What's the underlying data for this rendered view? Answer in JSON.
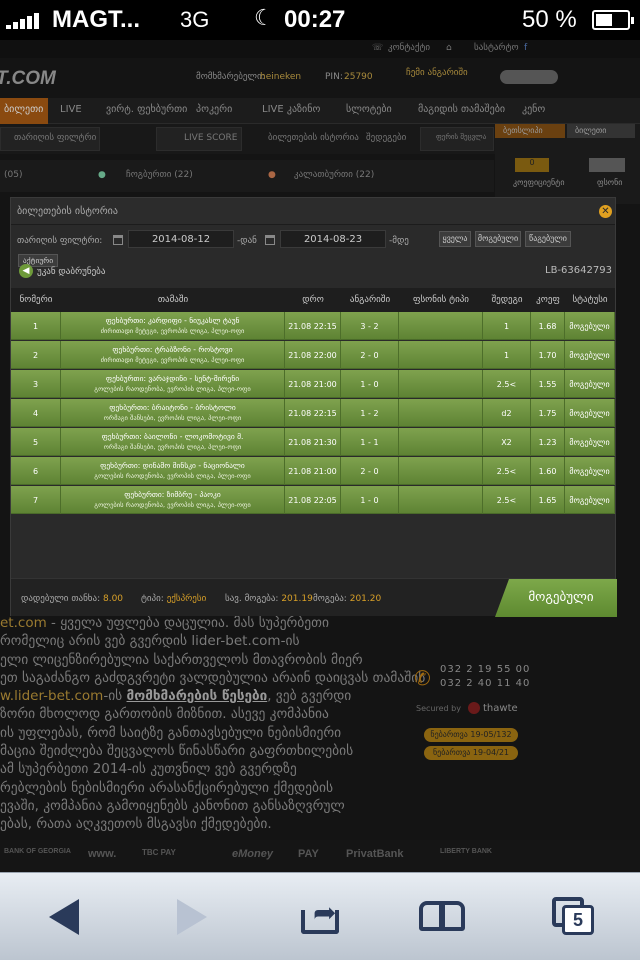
{
  "status_bar": {
    "carrier": "MAGT...",
    "network": "3G",
    "time": "00:27",
    "battery": "50 %",
    "battery_level": 0.5
  },
  "site": {
    "top_links": [
      "კონტაქტი",
      "სასტარტო"
    ],
    "logo": "T.COM",
    "user_label": "მომხმარებელი:",
    "username": "heineken",
    "pin_label": "PIN:",
    "pin": "25790",
    "balance_label": "ჩემი ანგარიში",
    "nav": [
      "ბილეთი",
      "LIVE",
      "ვირტ. ფეხბურთი",
      "პოკერი",
      "LIVE კაზინო",
      "სლოტები",
      "მაგიდის თამაშები",
      "კენო"
    ],
    "subnav": [
      "თარიღის ფილტრი",
      "LIVE SCORE",
      "ბილეთების ისტორია",
      "შედეგები",
      "ფერის შეცვლა"
    ],
    "sports": [
      "(05)",
      "ჩოგბურთი (22)",
      "კალათბურთი (22)"
    ],
    "side_tabs": [
      "ბეთსლიპი",
      "ბილეთი"
    ],
    "side_value": "0",
    "side_labels": [
      "კოეფიციენტი",
      "ფსონი"
    ],
    "footer_lines": [
      {
        "hl": "et.com",
        "rest": " - ყველა უფლება დაცულია. მას სუპერბეთი"
      },
      {
        "hl": "",
        "rest": "რომელიც არის ვებ გვერდის lider-bet.com-ის"
      },
      {
        "hl": "",
        "rest": "ელი ლიცენზირებულია საქართველოს მთავრობის მიერ"
      },
      {
        "hl": "",
        "rest": "ეთ საგაძანგო გაძდგვრეტი ვალდებულია არაინ დაიცვას თამაშის"
      },
      {
        "hl": "w.lider-bet.com",
        "rest": "-ის ",
        "ul": "მომხმარების წესები",
        "rest2": ", ვებ გვერდი"
      },
      {
        "hl": "",
        "rest": "ზორი მხოლოდ გართობის მიზნით. ასევე კომპანია"
      },
      {
        "hl": "",
        "rest": "ის უფლებას, რომ საიტზე განთავსებული ნებისმიერი"
      },
      {
        "hl": "",
        "rest": "მაცია შეიძლება შეცვალოს წინასწარი გაფრთხილების"
      },
      {
        "hl": "",
        "rest": "ამ სუპერბეთი 2014-ის კუთვნილ ვებ გვერდზე"
      },
      {
        "hl": "",
        "rest": "რებლების ნებისმიერი არასანქცირებული ქმედების"
      },
      {
        "hl": "",
        "rest": "ევაში, კომპანია გამოიყენებს კანონით განსაზღვრულ"
      },
      {
        "hl": "",
        "rest": "ებას, რათა აღკვეთოს მსგავსი ქმედებები."
      }
    ],
    "phones": [
      "032 2 19 55 00",
      "032 2 40 11 40"
    ],
    "secured_by": "Secured by",
    "thawte": "thawte",
    "licenses": [
      "ნებართვა 19-05/132",
      "ნებართვა 19-04/21"
    ],
    "banks": [
      "BANK OF GEORGIA",
      "www.",
      "TBC PAY",
      "eMoney",
      "PAY",
      "PrivatBank",
      "LIBERTY BANK"
    ]
  },
  "modal": {
    "title": "ბილეთების ისტორია",
    "filter_label": "თარიღის ფილტრი:",
    "date_from": "2014-08-12",
    "from_suffix": "-დან",
    "date_to": "2014-08-23",
    "to_suffix": "-მდე",
    "buttons": [
      "ყველა",
      "მოგებული",
      "წაგებული"
    ],
    "sub_button": "აქტიური",
    "back_label": "უკან დაბრუნება",
    "ticket_id": "LB-63642793",
    "columns": [
      "ნომერი",
      "თამაში",
      "დრო",
      "ანგარიში",
      "ფსონის ტიპი",
      "შედეგი",
      "კოეფ",
      "სტატუსი"
    ],
    "rows": [
      {
        "num": "1",
        "match": "ფეხბურთი: კარდიფი - ნიუკასლ ტაუნ",
        "league": "ძირითადი მეტეგი, ევროპის ლიგა, პლეი-ოფი",
        "time": "21.08 22:15",
        "score": "3 - 2",
        "bet_type": "",
        "result": "1",
        "odd": "1.68",
        "status": "მოგებული"
      },
      {
        "num": "2",
        "match": "ფეხბურთი: ტრაბზონი - როსტოვი",
        "league": "ძირითადი მეტეგი, ევროპის ლიგა, პლეი-ოფი",
        "time": "21.08 22:00",
        "score": "2 - 0",
        "bet_type": "",
        "result": "1",
        "odd": "1.70",
        "status": "მოგებული"
      },
      {
        "num": "3",
        "match": "ფეხბურთი: ვარაჯდინი - სენტ-მირენი",
        "league": "გოლების რაოდენობა, ევროპის ლიგა, პლეი-ოფი",
        "time": "21.08 21:00",
        "score": "1 - 0",
        "bet_type": "",
        "result": "2.5<",
        "odd": "1.55",
        "status": "მოგებული"
      },
      {
        "num": "4",
        "match": "ფეხბურთი: ბრაიტონი - ბრისტოლი",
        "league": "ორმაგი შანსები, ევროპის ლიგა, პლეი-ოფი",
        "time": "21.08 22:15",
        "score": "1 - 2",
        "bet_type": "",
        "result": "d2",
        "odd": "1.75",
        "status": "მოგებული"
      },
      {
        "num": "5",
        "match": "ფეხბურთი: ბაილონი - ლოკომოტივი მ.",
        "league": "ორმაგი შანსები, ევროპის ლიგა, პლეი-ოფი",
        "time": "21.08 21:30",
        "score": "1 - 1",
        "bet_type": "",
        "result": "X2",
        "odd": "1.23",
        "status": "მოგებული"
      },
      {
        "num": "6",
        "match": "ფეხბურთი: დინამო მინსკი - ნაციონალი",
        "league": "გოლების რაოდენობა, ევროპის ლიგა, პლეი-ოფი",
        "time": "21.08 21:00",
        "score": "2 - 0",
        "bet_type": "",
        "result": "2.5<",
        "odd": "1.60",
        "status": "მოგებული"
      },
      {
        "num": "7",
        "match": "ფეხბურთი: ზიმბრუ - პაოკი",
        "league": "გოლების რაოდენობა, ევროპის ლიგა, პლეი-ოფი",
        "time": "21.08 22:05",
        "score": "1 - 0",
        "bet_type": "",
        "result": "2.5<",
        "odd": "1.65",
        "status": "მოგებული"
      }
    ],
    "summary": {
      "stake_label": "დადებული თანხა:",
      "stake": "8.00",
      "type_label": "ტიპი:",
      "type": "ექსპრესი",
      "potential_label": "სავ. მოგება:",
      "potential": "201.19",
      "win_label": "მოგება:",
      "win": "201.20",
      "status": "მოგებული"
    }
  },
  "colors": {
    "accent": "#e0a020",
    "row_green": "#6e9440",
    "status_green": "#74a03e"
  }
}
